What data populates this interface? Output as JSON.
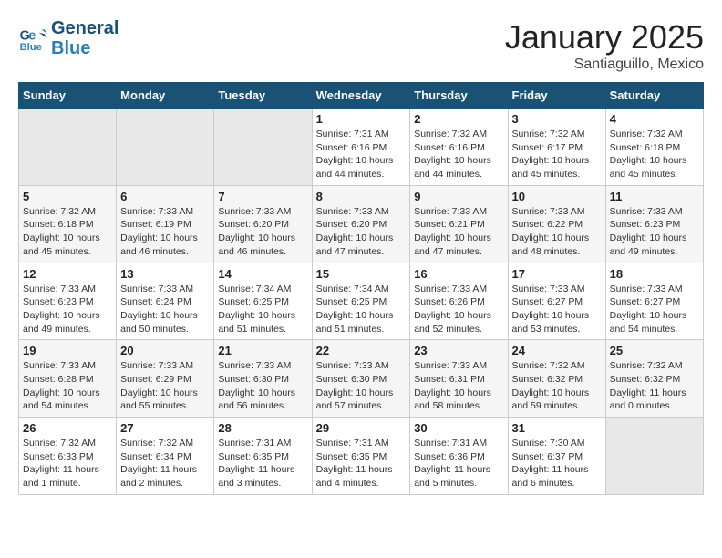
{
  "header": {
    "logo_line1": "General",
    "logo_line2": "Blue",
    "month": "January 2025",
    "location": "Santiaguillo, Mexico"
  },
  "weekdays": [
    "Sunday",
    "Monday",
    "Tuesday",
    "Wednesday",
    "Thursday",
    "Friday",
    "Saturday"
  ],
  "weeks": [
    [
      {
        "day": "",
        "sunrise": "",
        "sunset": "",
        "daylight": ""
      },
      {
        "day": "",
        "sunrise": "",
        "sunset": "",
        "daylight": ""
      },
      {
        "day": "",
        "sunrise": "",
        "sunset": "",
        "daylight": ""
      },
      {
        "day": "1",
        "sunrise": "Sunrise: 7:31 AM",
        "sunset": "Sunset: 6:16 PM",
        "daylight": "Daylight: 10 hours and 44 minutes."
      },
      {
        "day": "2",
        "sunrise": "Sunrise: 7:32 AM",
        "sunset": "Sunset: 6:16 PM",
        "daylight": "Daylight: 10 hours and 44 minutes."
      },
      {
        "day": "3",
        "sunrise": "Sunrise: 7:32 AM",
        "sunset": "Sunset: 6:17 PM",
        "daylight": "Daylight: 10 hours and 45 minutes."
      },
      {
        "day": "4",
        "sunrise": "Sunrise: 7:32 AM",
        "sunset": "Sunset: 6:18 PM",
        "daylight": "Daylight: 10 hours and 45 minutes."
      }
    ],
    [
      {
        "day": "5",
        "sunrise": "Sunrise: 7:32 AM",
        "sunset": "Sunset: 6:18 PM",
        "daylight": "Daylight: 10 hours and 45 minutes."
      },
      {
        "day": "6",
        "sunrise": "Sunrise: 7:33 AM",
        "sunset": "Sunset: 6:19 PM",
        "daylight": "Daylight: 10 hours and 46 minutes."
      },
      {
        "day": "7",
        "sunrise": "Sunrise: 7:33 AM",
        "sunset": "Sunset: 6:20 PM",
        "daylight": "Daylight: 10 hours and 46 minutes."
      },
      {
        "day": "8",
        "sunrise": "Sunrise: 7:33 AM",
        "sunset": "Sunset: 6:20 PM",
        "daylight": "Daylight: 10 hours and 47 minutes."
      },
      {
        "day": "9",
        "sunrise": "Sunrise: 7:33 AM",
        "sunset": "Sunset: 6:21 PM",
        "daylight": "Daylight: 10 hours and 47 minutes."
      },
      {
        "day": "10",
        "sunrise": "Sunrise: 7:33 AM",
        "sunset": "Sunset: 6:22 PM",
        "daylight": "Daylight: 10 hours and 48 minutes."
      },
      {
        "day": "11",
        "sunrise": "Sunrise: 7:33 AM",
        "sunset": "Sunset: 6:23 PM",
        "daylight": "Daylight: 10 hours and 49 minutes."
      }
    ],
    [
      {
        "day": "12",
        "sunrise": "Sunrise: 7:33 AM",
        "sunset": "Sunset: 6:23 PM",
        "daylight": "Daylight: 10 hours and 49 minutes."
      },
      {
        "day": "13",
        "sunrise": "Sunrise: 7:33 AM",
        "sunset": "Sunset: 6:24 PM",
        "daylight": "Daylight: 10 hours and 50 minutes."
      },
      {
        "day": "14",
        "sunrise": "Sunrise: 7:34 AM",
        "sunset": "Sunset: 6:25 PM",
        "daylight": "Daylight: 10 hours and 51 minutes."
      },
      {
        "day": "15",
        "sunrise": "Sunrise: 7:34 AM",
        "sunset": "Sunset: 6:25 PM",
        "daylight": "Daylight: 10 hours and 51 minutes."
      },
      {
        "day": "16",
        "sunrise": "Sunrise: 7:33 AM",
        "sunset": "Sunset: 6:26 PM",
        "daylight": "Daylight: 10 hours and 52 minutes."
      },
      {
        "day": "17",
        "sunrise": "Sunrise: 7:33 AM",
        "sunset": "Sunset: 6:27 PM",
        "daylight": "Daylight: 10 hours and 53 minutes."
      },
      {
        "day": "18",
        "sunrise": "Sunrise: 7:33 AM",
        "sunset": "Sunset: 6:27 PM",
        "daylight": "Daylight: 10 hours and 54 minutes."
      }
    ],
    [
      {
        "day": "19",
        "sunrise": "Sunrise: 7:33 AM",
        "sunset": "Sunset: 6:28 PM",
        "daylight": "Daylight: 10 hours and 54 minutes."
      },
      {
        "day": "20",
        "sunrise": "Sunrise: 7:33 AM",
        "sunset": "Sunset: 6:29 PM",
        "daylight": "Daylight: 10 hours and 55 minutes."
      },
      {
        "day": "21",
        "sunrise": "Sunrise: 7:33 AM",
        "sunset": "Sunset: 6:30 PM",
        "daylight": "Daylight: 10 hours and 56 minutes."
      },
      {
        "day": "22",
        "sunrise": "Sunrise: 7:33 AM",
        "sunset": "Sunset: 6:30 PM",
        "daylight": "Daylight: 10 hours and 57 minutes."
      },
      {
        "day": "23",
        "sunrise": "Sunrise: 7:33 AM",
        "sunset": "Sunset: 6:31 PM",
        "daylight": "Daylight: 10 hours and 58 minutes."
      },
      {
        "day": "24",
        "sunrise": "Sunrise: 7:32 AM",
        "sunset": "Sunset: 6:32 PM",
        "daylight": "Daylight: 10 hours and 59 minutes."
      },
      {
        "day": "25",
        "sunrise": "Sunrise: 7:32 AM",
        "sunset": "Sunset: 6:32 PM",
        "daylight": "Daylight: 11 hours and 0 minutes."
      }
    ],
    [
      {
        "day": "26",
        "sunrise": "Sunrise: 7:32 AM",
        "sunset": "Sunset: 6:33 PM",
        "daylight": "Daylight: 11 hours and 1 minute."
      },
      {
        "day": "27",
        "sunrise": "Sunrise: 7:32 AM",
        "sunset": "Sunset: 6:34 PM",
        "daylight": "Daylight: 11 hours and 2 minutes."
      },
      {
        "day": "28",
        "sunrise": "Sunrise: 7:31 AM",
        "sunset": "Sunset: 6:35 PM",
        "daylight": "Daylight: 11 hours and 3 minutes."
      },
      {
        "day": "29",
        "sunrise": "Sunrise: 7:31 AM",
        "sunset": "Sunset: 6:35 PM",
        "daylight": "Daylight: 11 hours and 4 minutes."
      },
      {
        "day": "30",
        "sunrise": "Sunrise: 7:31 AM",
        "sunset": "Sunset: 6:36 PM",
        "daylight": "Daylight: 11 hours and 5 minutes."
      },
      {
        "day": "31",
        "sunrise": "Sunrise: 7:30 AM",
        "sunset": "Sunset: 6:37 PM",
        "daylight": "Daylight: 11 hours and 6 minutes."
      },
      {
        "day": "",
        "sunrise": "",
        "sunset": "",
        "daylight": ""
      }
    ]
  ]
}
